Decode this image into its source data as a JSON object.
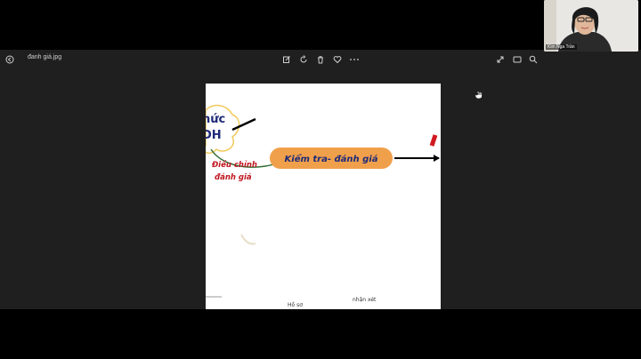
{
  "viewer": {
    "filename": "đanh giá.jpg",
    "icons": {
      "back": "back-icon",
      "edit": "edit-icon",
      "rotate": "rotate-icon",
      "delete": "trash-icon",
      "favorite": "heart-icon",
      "more": "more-icon",
      "expand": "expand-icon",
      "slideshow": "slideshow-icon",
      "zoom": "zoom-icon"
    }
  },
  "mindmap": {
    "partial_top_text_1": "hức",
    "partial_top_text_2": "DH",
    "left_label_1": "Điều chỉnh",
    "left_label_2": "đánh giá",
    "center_node": "Kiểm tra- đánh giá",
    "bottom_text_1": "Hồ sơ",
    "bottom_text_2": "nhận xét"
  },
  "webcam": {
    "name": "Kim Nga Trần"
  },
  "colors": {
    "center_node_fill": "#f0a04b",
    "center_node_text": "#1e2a78",
    "left_label": "#c0161f",
    "top_text": "#1e2a78"
  }
}
